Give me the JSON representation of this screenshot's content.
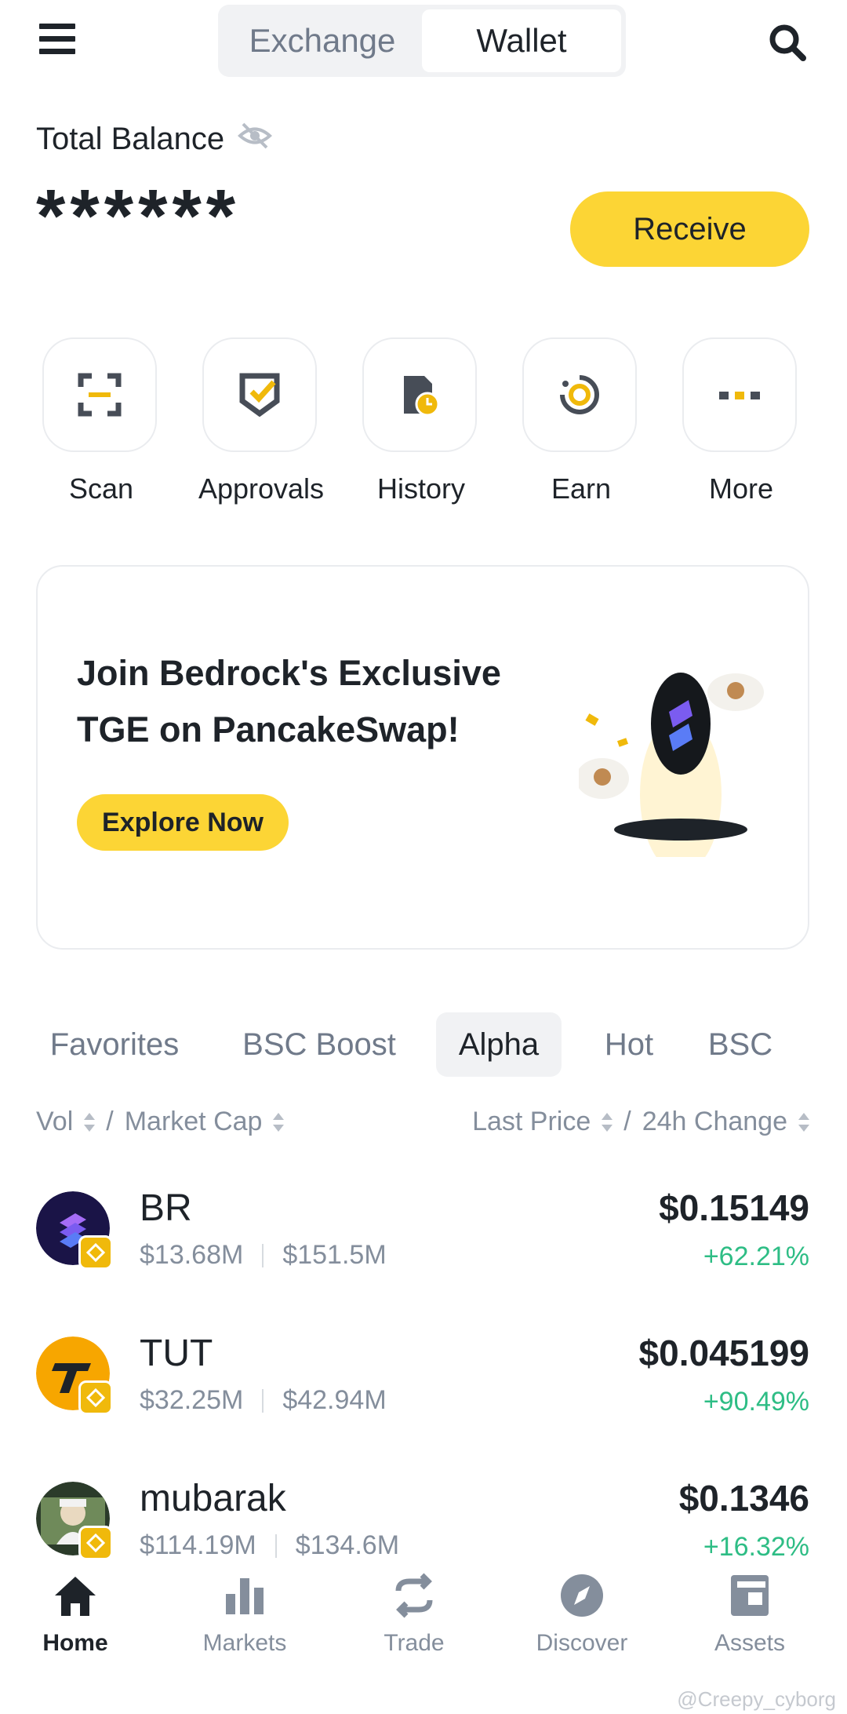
{
  "header": {
    "tabs": [
      "Exchange",
      "Wallet"
    ],
    "active_tab": "Wallet"
  },
  "balance": {
    "label": "Total Balance",
    "value": "******",
    "receive_label": "Receive"
  },
  "quick_actions": [
    {
      "label": "Scan",
      "icon": "scan-icon"
    },
    {
      "label": "Approvals",
      "icon": "shield-check-icon"
    },
    {
      "label": "History",
      "icon": "history-icon"
    },
    {
      "label": "Earn",
      "icon": "earn-icon"
    },
    {
      "label": "More",
      "icon": "more-icon"
    }
  ],
  "banner": {
    "title": "Join Bedrock's Exclusive TGE on PancakeSwap!",
    "button_label": "Explore Now"
  },
  "market_tabs": [
    "Favorites",
    "BSC Boost",
    "Alpha",
    "Hot",
    "BSC"
  ],
  "active_market_tab": "Alpha",
  "sort": {
    "left_a": "Vol",
    "left_b": "Market Cap",
    "right_a": "Last Price",
    "right_b": "24h Change",
    "divider": "/"
  },
  "tokens": [
    {
      "name": "BR",
      "vol": "$13.68M",
      "mcap": "$151.5M",
      "price": "$0.15149",
      "change": "+62.21%"
    },
    {
      "name": "TUT",
      "vol": "$32.25M",
      "mcap": "$42.94M",
      "price": "$0.045199",
      "change": "+90.49%"
    },
    {
      "name": "mubarak",
      "vol": "$114.19M",
      "mcap": "$134.6M",
      "price": "$0.1346",
      "change": "+16.32%"
    }
  ],
  "bottom_nav": [
    {
      "label": "Home",
      "icon": "home-icon",
      "active": true
    },
    {
      "label": "Markets",
      "icon": "bar-chart-icon",
      "active": false
    },
    {
      "label": "Trade",
      "icon": "trade-icon",
      "active": false
    },
    {
      "label": "Discover",
      "icon": "compass-icon",
      "active": false
    },
    {
      "label": "Assets",
      "icon": "wallet-icon",
      "active": false
    }
  ],
  "watermark": "@Creepy_cyborg",
  "colors": {
    "accent": "#fcd535",
    "positive": "#2ebd85",
    "text_primary": "#1e2329",
    "text_secondary": "#848e9c"
  }
}
